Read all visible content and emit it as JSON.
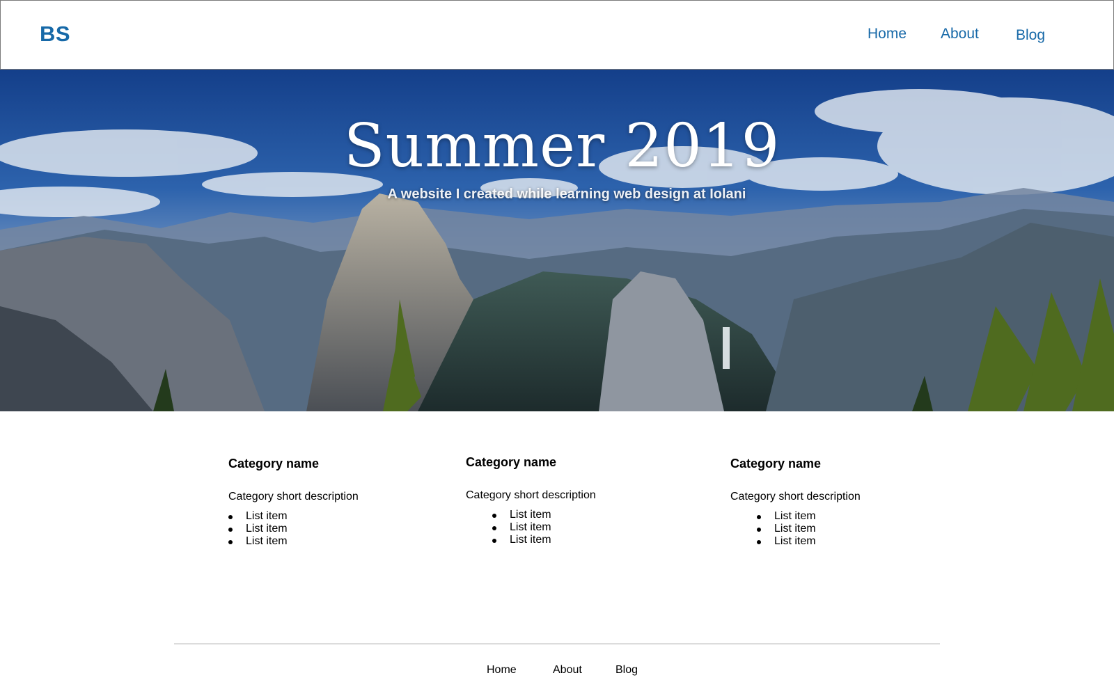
{
  "header": {
    "logo": "BS",
    "nav": [
      "Home",
      "About",
      "Blog"
    ],
    "link_color": "#1769a8"
  },
  "hero": {
    "title": "Summer 2019",
    "subtitle": "A website I created while learning web design at Iolani",
    "image": "mountain-valley-landscape"
  },
  "categories": [
    {
      "title": "Category name",
      "description": "Category short description",
      "items": [
        "List item",
        "List item",
        "List item"
      ]
    },
    {
      "title": "Category name",
      "description": "Category short description",
      "items": [
        "List item",
        "List item",
        "List item"
      ]
    },
    {
      "title": "Category name",
      "description": "Category short description",
      "items": [
        "List item",
        "List item",
        "List item"
      ]
    }
  ],
  "footer": {
    "nav": [
      "Home",
      "About",
      "Blog"
    ]
  }
}
